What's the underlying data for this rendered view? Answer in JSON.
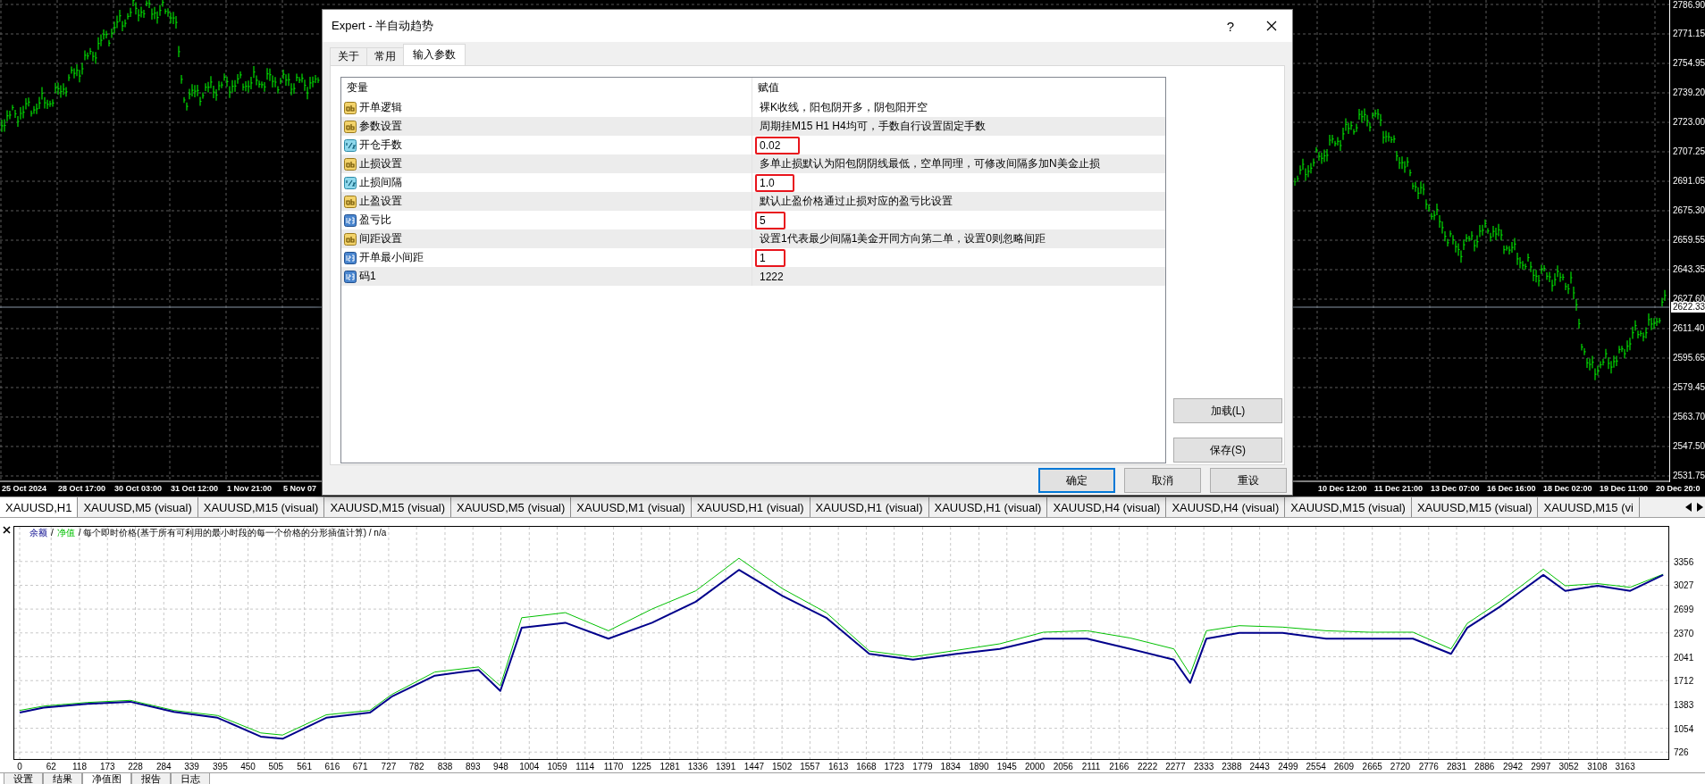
{
  "price_chart": {
    "price_labels": [
      "2786.90",
      "2771.15",
      "2754.95",
      "2739.20",
      "2723.00",
      "2707.25",
      "2691.05",
      "2675.30",
      "2659.55",
      "2643.35",
      "2627.60",
      "2611.40",
      "2595.65",
      "2579.45",
      "2563.70",
      "2547.50",
      "2531.75"
    ],
    "current_price": "2622.33",
    "time_labels_left": [
      "25 Oct 2024",
      "28 Oct 17:00",
      "30 Oct 03:00",
      "31 Oct 12:00",
      "1 Nov 21:00",
      "5 Nov 07"
    ],
    "time_labels_right": [
      "10 Dec 12:00",
      "11 Dec 21:00",
      "13 Dec 07:00",
      "16 Dec 16:00",
      "18 Dec 02:00",
      "19 Dec 11:00",
      "20 Dec 20:0"
    ]
  },
  "chart_tabs": [
    {
      "label": "XAUUSD,H1",
      "selected": true
    },
    {
      "label": "XAUUSD,M5 (visual)",
      "selected": false
    },
    {
      "label": "XAUUSD,M15 (visual)",
      "selected": false
    },
    {
      "label": "XAUUSD,M15 (visual)",
      "selected": false
    },
    {
      "label": "XAUUSD,M5 (visual)",
      "selected": false
    },
    {
      "label": "XAUUSD,M1 (visual)",
      "selected": false
    },
    {
      "label": "XAUUSD,H1 (visual)",
      "selected": false
    },
    {
      "label": "XAUUSD,H1 (visual)",
      "selected": false
    },
    {
      "label": "XAUUSD,H1 (visual)",
      "selected": false
    },
    {
      "label": "XAUUSD,H4 (visual)",
      "selected": false
    },
    {
      "label": "XAUUSD,H4 (visual)",
      "selected": false
    },
    {
      "label": "XAUUSD,M15 (visual)",
      "selected": false
    },
    {
      "label": "XAUUSD,M15 (visual)",
      "selected": false
    },
    {
      "label": "XAUUSD,M15 (vi",
      "selected": false
    }
  ],
  "dialog": {
    "title": "Expert - 半自动趋势",
    "help_button": "?",
    "tabs": [
      {
        "label": "关于",
        "selected": false
      },
      {
        "label": "常用",
        "selected": false
      },
      {
        "label": "输入参数",
        "selected": true
      }
    ],
    "columns": [
      "变量",
      "赋值"
    ],
    "rows": [
      {
        "kind": "string",
        "name": "开单逻辑",
        "value": "裸K收线，阳包阴开多，阴包阳开空",
        "highlighted": false
      },
      {
        "kind": "string",
        "name": "参数设置",
        "value": "周期挂M15 H1 H4均可，手数自行设置固定手数",
        "highlighted": false
      },
      {
        "kind": "double",
        "name": "开仓手数",
        "value": "0.02",
        "highlighted": true
      },
      {
        "kind": "string",
        "name": "止损设置",
        "value": "多单止损默认为阳包阴阴线最低，空单同理，可修改间隔多加N美金止损",
        "highlighted": false
      },
      {
        "kind": "double",
        "name": "止损间隔",
        "value": "1.0",
        "highlighted": true
      },
      {
        "kind": "string",
        "name": "止盈设置",
        "value": "默认止盈价格通过止损对应的盈亏比设置",
        "highlighted": false
      },
      {
        "kind": "int",
        "name": "盈亏比",
        "value": "5",
        "highlighted": true
      },
      {
        "kind": "string",
        "name": "间距设置",
        "value": "设置1代表最少间隔1美金开同方向第二单，设置0则忽略间距",
        "highlighted": false
      },
      {
        "kind": "int",
        "name": "开单最小间距",
        "value": "1",
        "highlighted": true
      },
      {
        "kind": "int",
        "name": "码1",
        "value": "1222",
        "highlighted": false
      }
    ],
    "side_buttons": [
      "加载(L)",
      "保存(S)"
    ],
    "buttons": [
      {
        "label": "确定",
        "default": true
      },
      {
        "label": "取消",
        "default": false
      },
      {
        "label": "重设",
        "default": false
      }
    ]
  },
  "equity_chart": {
    "legend_separator": "/",
    "header_text": "/ 每个即时价格(基于所有可利用的最小时段的每一个价格的分形插值计算) / n/a",
    "chart_data": {
      "type": "line",
      "x": [
        0,
        47,
        133,
        218,
        304,
        390,
        475,
        518,
        604,
        690,
        733,
        818,
        904,
        947,
        989,
        1075,
        1160,
        1246,
        1332,
        1417,
        1503,
        1589,
        1674,
        1760,
        1846,
        1931,
        2017,
        2103,
        2188,
        2274,
        2306,
        2338,
        2403,
        2488,
        2574,
        2660,
        2745,
        2820,
        2852,
        2916,
        2959,
        3002,
        3045,
        3109,
        3173,
        3238
      ],
      "series": [
        {
          "name": "余额",
          "color": "#00008b",
          "values": [
            1270,
            1340,
            1390,
            1420,
            1280,
            1200,
            940,
            910,
            1200,
            1270,
            1490,
            1780,
            1860,
            1570,
            2440,
            2510,
            2290,
            2510,
            2800,
            3240,
            2880,
            2580,
            2080,
            2000,
            2080,
            2150,
            2290,
            2290,
            2150,
            2000,
            1680,
            2290,
            2370,
            2370,
            2290,
            2290,
            2290,
            2080,
            2440,
            2730,
            2950,
            3170,
            2950,
            3020,
            2950,
            3170
          ]
        },
        {
          "name": "净值",
          "color": "#00c000",
          "values": [
            1300,
            1360,
            1410,
            1440,
            1300,
            1230,
            990,
            960,
            1240,
            1300,
            1520,
            1830,
            1900,
            1640,
            2580,
            2650,
            2400,
            2700,
            2950,
            3400,
            2980,
            2650,
            2120,
            2040,
            2130,
            2220,
            2380,
            2400,
            2300,
            2150,
            1800,
            2400,
            2470,
            2450,
            2400,
            2380,
            2380,
            2150,
            2500,
            2800,
            3020,
            3250,
            3020,
            3050,
            3000,
            3180
          ]
        }
      ],
      "xlim": [
        0,
        3250
      ],
      "ylim": [
        618,
        3846
      ],
      "grid": true,
      "xticks": [
        0,
        62,
        118,
        173,
        228,
        284,
        339,
        395,
        450,
        505,
        561,
        616,
        671,
        727,
        782,
        838,
        893,
        948,
        1004,
        1059,
        1114,
        1170,
        1225,
        1281,
        1336,
        1391,
        1447,
        1502,
        1557,
        1613,
        1668,
        1723,
        1779,
        1834,
        1890,
        1945,
        2000,
        2056,
        2111,
        2166,
        2222,
        2277,
        2333,
        2388,
        2443,
        2499,
        2554,
        2609,
        2665,
        2720,
        2776,
        2831,
        2886,
        2942,
        2997,
        3052,
        3108,
        3163
      ],
      "yticks": [
        726,
        1054,
        1383,
        1712,
        2041,
        2370,
        2699,
        3027,
        3356
      ]
    }
  },
  "tester_tabs": [
    {
      "label": "设置",
      "selected": false
    },
    {
      "label": "结果",
      "selected": false
    },
    {
      "label": "净值图",
      "selected": true
    },
    {
      "label": "报告",
      "selected": false
    },
    {
      "label": "日志",
      "selected": false
    }
  ]
}
